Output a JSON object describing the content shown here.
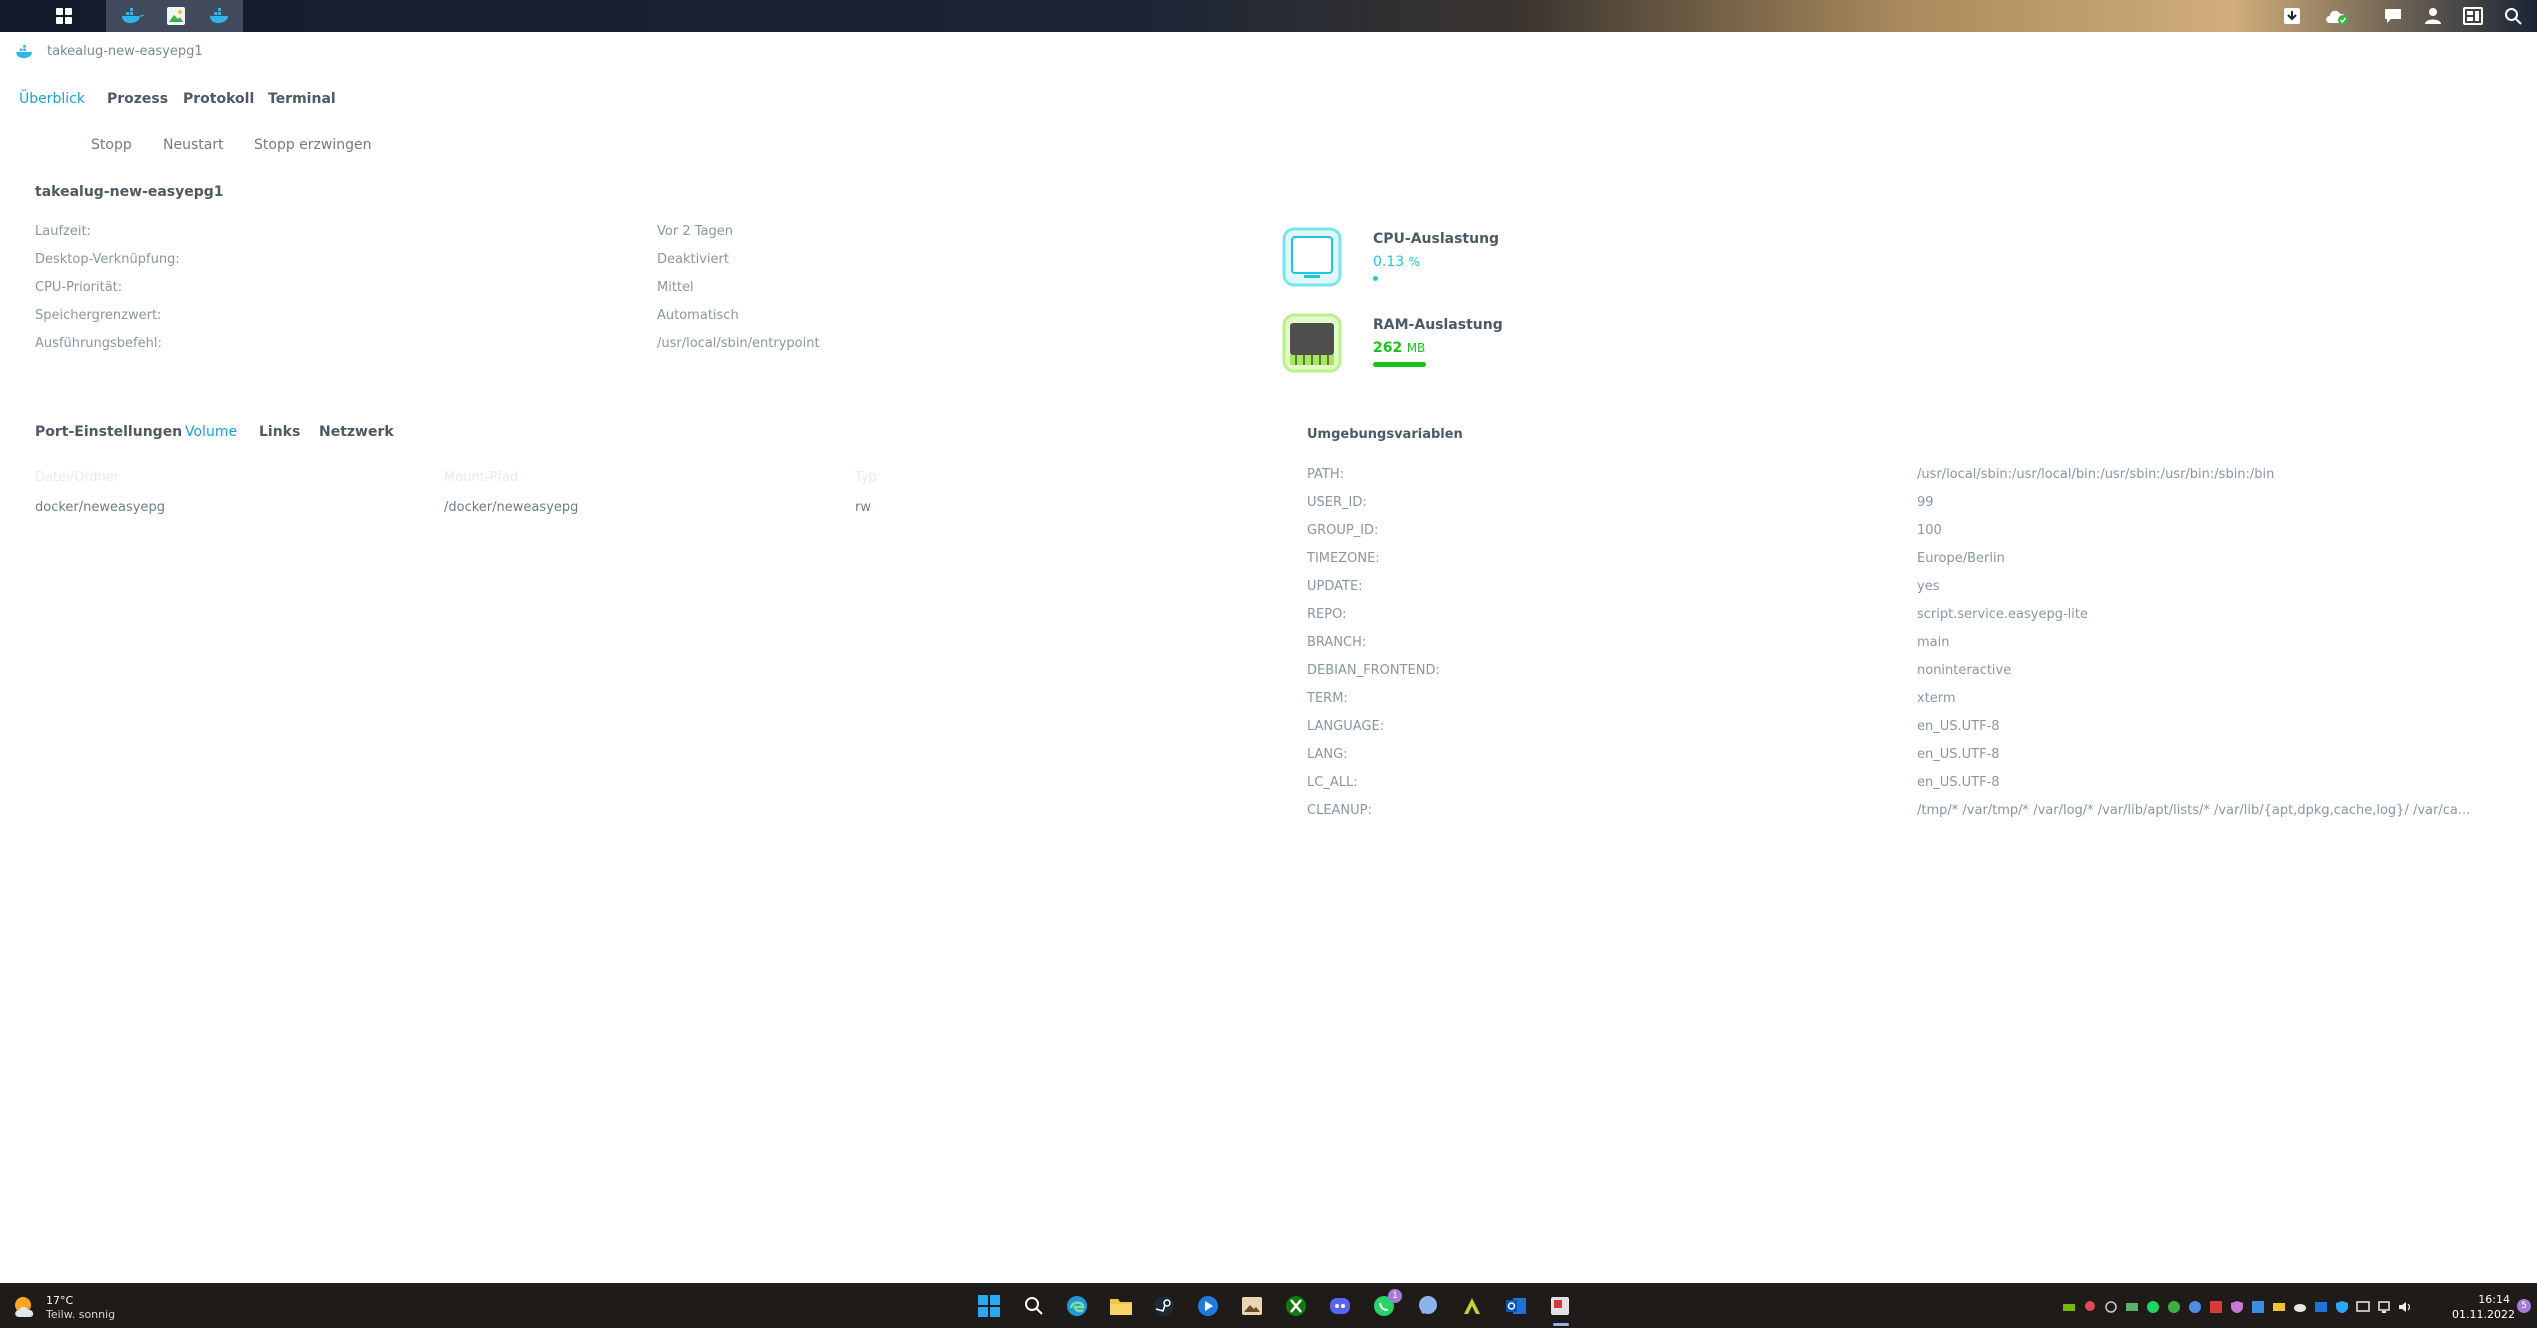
{
  "window": {
    "title": "takealug-new-easyepg1"
  },
  "tabs": [
    {
      "label": "Überblick"
    },
    {
      "label": "Prozess"
    },
    {
      "label": "Protokoll"
    },
    {
      "label": "Terminal"
    }
  ],
  "actions": {
    "stop": "Stopp",
    "restart": "Neustart",
    "force_stop": "Stopp erzwingen"
  },
  "overview": {
    "container_name": "takealug-new-easyepg1",
    "rows": [
      {
        "label": "Laufzeit:",
        "value": "Vor 2 Tagen"
      },
      {
        "label": "Desktop-Verknüpfung:",
        "value": "Deaktiviert"
      },
      {
        "label": "CPU-Priorität:",
        "value": "Mittel"
      },
      {
        "label": "Speichergrenzwert:",
        "value": "Automatisch"
      },
      {
        "label": "Ausführungsbefehl:",
        "value": "/usr/local/sbin/entrypoint"
      }
    ]
  },
  "resources": {
    "cpu": {
      "label": "CPU-Auslastung",
      "value": "0.13",
      "unit": "%",
      "percent": 0.13
    },
    "ram": {
      "label": "RAM-Auslastung",
      "value": "262",
      "unit": "MB",
      "fill_fraction": 0.62
    }
  },
  "subtabs": [
    {
      "label": "Port-Einstellungen"
    },
    {
      "label": "Volume"
    },
    {
      "label": "Links"
    },
    {
      "label": "Netzwerk"
    }
  ],
  "volume_table": {
    "headers": [
      "Datei/Ordner",
      "Mount-Pfad",
      "Typ"
    ],
    "rows": [
      [
        "docker/neweasyepg",
        "/docker/neweasyepg",
        "rw"
      ]
    ]
  },
  "env": {
    "title": "Umgebungsvariablen",
    "rows": [
      {
        "key": "PATH:",
        "value": "/usr/local/sbin:/usr/local/bin:/usr/sbin:/usr/bin:/sbin:/bin"
      },
      {
        "key": "USER_ID:",
        "value": "99"
      },
      {
        "key": "GROUP_ID:",
        "value": "100"
      },
      {
        "key": "TIMEZONE:",
        "value": "Europe/Berlin"
      },
      {
        "key": "UPDATE:",
        "value": "yes"
      },
      {
        "key": "REPO:",
        "value": "script.service.easyepg-lite"
      },
      {
        "key": "BRANCH:",
        "value": "main"
      },
      {
        "key": "DEBIAN_FRONTEND:",
        "value": "noninteractive"
      },
      {
        "key": "TERM:",
        "value": "xterm"
      },
      {
        "key": "LANGUAGE:",
        "value": "en_US.UTF-8"
      },
      {
        "key": "LANG:",
        "value": "en_US.UTF-8"
      },
      {
        "key": "LC_ALL:",
        "value": "en_US.UTF-8"
      },
      {
        "key": "CLEANUP:",
        "value": "/tmp/* /var/tmp/* /var/log/* /var/lib/apt/lists/* /var/lib/{apt,dpkg,cache,log}/ /var/ca..."
      }
    ]
  },
  "weather": {
    "temp": "17°C",
    "desc": "Teilw. sonnig"
  },
  "clock": {
    "time": "16:14",
    "date": "01.11.2022"
  },
  "badges": {
    "whatsapp": "1",
    "notifications": "5"
  },
  "colors": {
    "accent": "#15a2d6",
    "cpu": "#20c5d9",
    "ram": "#16c416"
  }
}
